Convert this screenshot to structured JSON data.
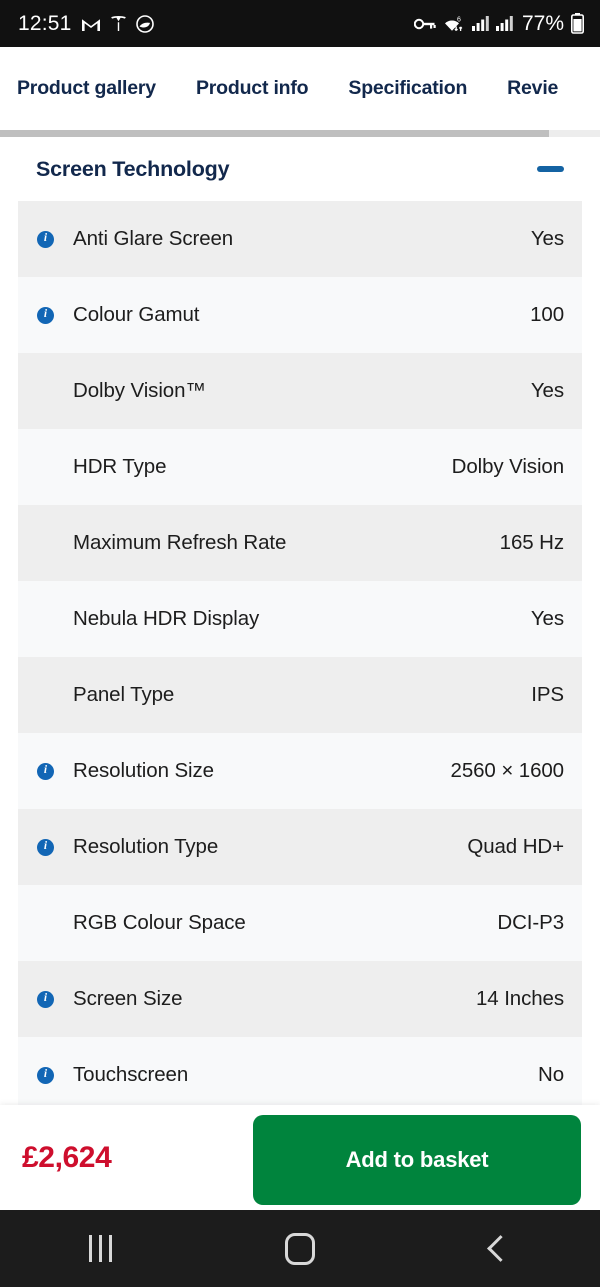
{
  "status_bar": {
    "time": "12:51",
    "left_icons": [
      "gmail-icon",
      "tesla-icon",
      "app-circle-icon"
    ],
    "right_icons": [
      "vpn-key-icon",
      "wifi-6-icon",
      "signal-bars-icon",
      "signal-bars-2-icon"
    ],
    "battery_percent": "77%",
    "battery_icon": "battery-icon"
  },
  "tabs": [
    {
      "label": "Product gallery",
      "active": false
    },
    {
      "label": "Product info",
      "active": false
    },
    {
      "label": "Specification",
      "active": true
    },
    {
      "label": "Revie",
      "active": false
    }
  ],
  "section": {
    "title": "Screen Technology",
    "collapse_icon": "minus-icon",
    "expanded": true
  },
  "spec_rows": [
    {
      "label": "Anti Glare Screen",
      "value": "Yes",
      "info": true
    },
    {
      "label": "Colour Gamut",
      "value": "100",
      "info": true
    },
    {
      "label": "Dolby Vision™",
      "value": "Yes",
      "info": false
    },
    {
      "label": "HDR Type",
      "value": "Dolby Vision",
      "info": false
    },
    {
      "label": "Maximum Refresh Rate",
      "value": "165 Hz",
      "info": false
    },
    {
      "label": "Nebula HDR Display",
      "value": "Yes",
      "info": false
    },
    {
      "label": "Panel Type",
      "value": "IPS",
      "info": false
    },
    {
      "label": "Resolution Size",
      "value": "2560 × 1600",
      "info": true
    },
    {
      "label": "Resolution Type",
      "value": "Quad HD+",
      "info": true
    },
    {
      "label": "RGB Colour Space",
      "value": "DCI-P3",
      "info": false
    },
    {
      "label": "Screen Size",
      "value": "14 Inches",
      "info": true
    },
    {
      "label": "Touchscreen",
      "value": "No",
      "info": true
    }
  ],
  "buy_bar": {
    "price": "£2,624",
    "add_to_basket_label": "Add to basket"
  },
  "nav_bar": {
    "recents_label": "recents-icon",
    "home_label": "home-icon",
    "back_label": "back-icon"
  },
  "colors": {
    "brand_navy": "#12284c",
    "info_blue": "#1266b5",
    "price_red": "#ce0e2d",
    "basket_green": "#00843d",
    "row_odd": "#eeeeee",
    "row_even": "#f8f9fa"
  }
}
